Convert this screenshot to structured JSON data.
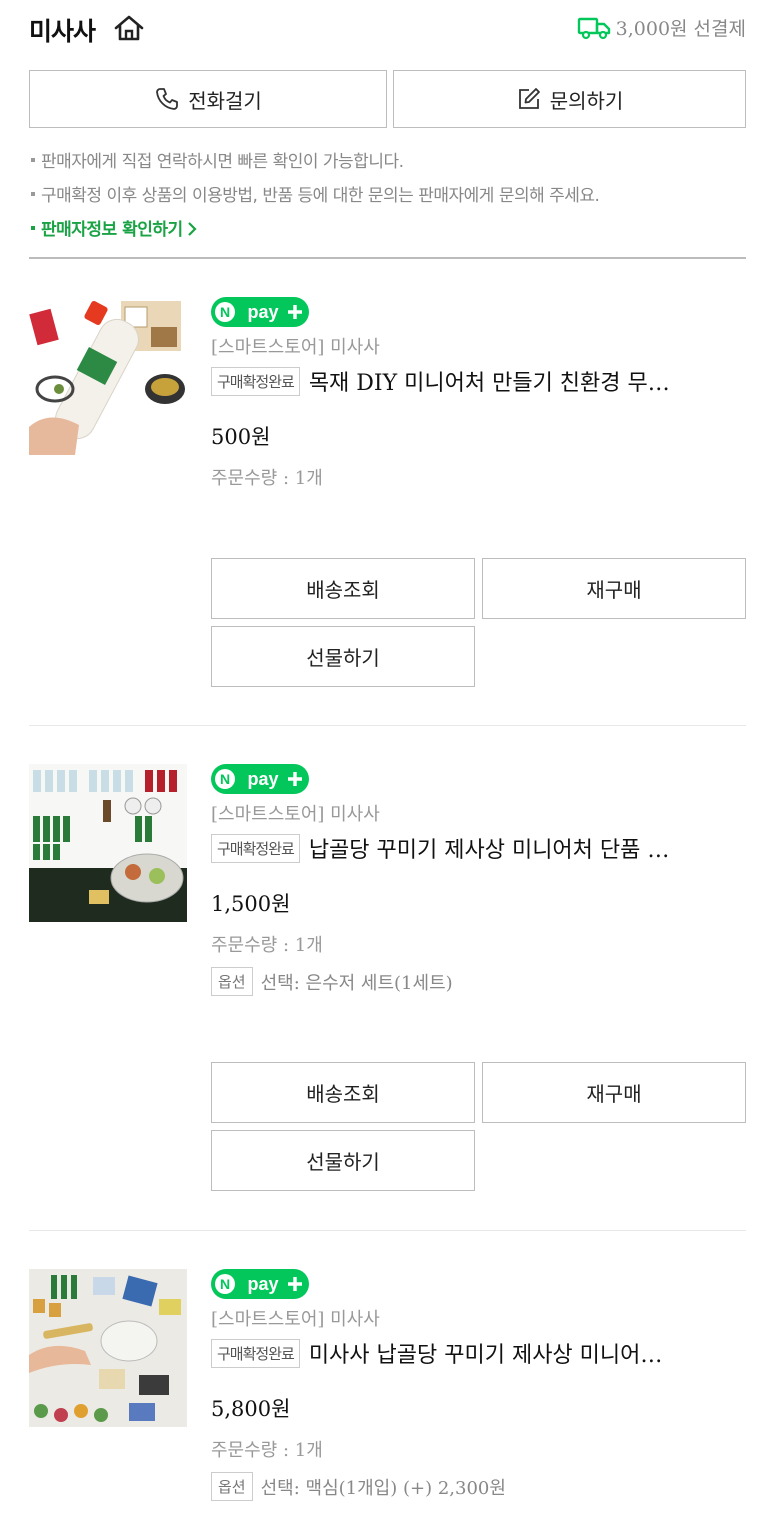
{
  "store": {
    "name": "미사사",
    "shipping_fee": "3,000원 선결제"
  },
  "contact": {
    "call_label": "전화걸기",
    "inquiry_label": "문의하기"
  },
  "notices": [
    "판매자에게 직접 연락하시면 빠른 확인이 가능합니다.",
    "구매확정 이후 상품의 이용방법, 반품 등에 대한 문의는 판매자에게 문의해 주세요.",
    "판매자정보 확인하기"
  ],
  "items": [
    {
      "badge": "N pay +",
      "seller": "[스마트스토어] 미사사",
      "status": "구매확정완료",
      "title": "목재 DIY 미니어처 만들기 친환경 무…",
      "price": "500원",
      "quantity": "주문수량 : 1개",
      "option_tag": "",
      "option": "",
      "actions": {
        "track": "배송조회",
        "rebuy": "재구매",
        "gift": "선물하기"
      }
    },
    {
      "badge": "N pay +",
      "seller": "[스마트스토어] 미사사",
      "status": "구매확정완료",
      "title": "납골당 꾸미기 제사상 미니어처 단품 …",
      "price": "1,500원",
      "quantity": "주문수량 : 1개",
      "option_tag": "옵션",
      "option": "선택: 은수저 세트(1세트)",
      "actions": {
        "track": "배송조회",
        "rebuy": "재구매",
        "gift": "선물하기"
      }
    },
    {
      "badge": "N pay +",
      "seller": "[스마트스토어] 미사사",
      "status": "구매확정완료",
      "title": "미사사 납골당 꾸미기 제사상 미니어…",
      "price": "5,800원",
      "quantity": "주문수량 : 1개",
      "option_tag": "옵션",
      "option": "선택: 맥심(1개입) (+) 2,300원"
    }
  ],
  "colors": {
    "naver_green": "#03c75a",
    "link_green": "#1aa345",
    "border": "#bdbdbd"
  },
  "icons": [
    "home-icon",
    "truck-icon",
    "phone-icon",
    "edit-icon",
    "chevron-right-icon"
  ]
}
